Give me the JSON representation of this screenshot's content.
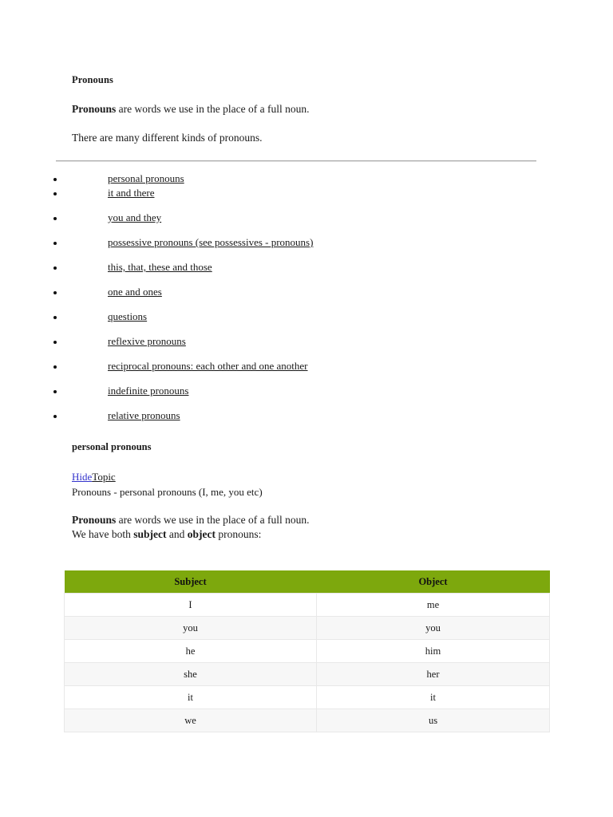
{
  "document": {
    "title": "Pronouns",
    "intro": {
      "lead": "Pronouns",
      "rest": " are words we use in the place of a full noun.",
      "second_line": "There are many different kinds of pronouns."
    },
    "topics": [
      {
        "label": "personal pronouns"
      },
      {
        "label": "it and there"
      },
      {
        "label": "you and they"
      },
      {
        "label": "possessive pronouns (see possessives - pronouns)"
      },
      {
        "label": "this, that, these and those"
      },
      {
        "label": "one and ones"
      },
      {
        "label": "questions"
      },
      {
        "label": "reflexive pronouns"
      },
      {
        "label": "reciprocal pronouns: each other and one another"
      },
      {
        "label": "indefinite pronouns"
      },
      {
        "label": "relative pronouns"
      }
    ],
    "section": {
      "heading": "personal pronouns",
      "hide_label": "Hide",
      "topic_label": "Topic",
      "subtitle": "Pronouns - personal pronouns (I, me, you etc)",
      "description_lead": "Pronouns",
      "description_rest": " are words we use in the place of a full noun.",
      "description_line2_prefix": "We have both ",
      "description_line2_bold1": "subject",
      "description_line2_mid": " and ",
      "description_line2_bold2": "object",
      "description_line2_suffix": " pronouns:"
    },
    "table": {
      "header_background": "#7da80d",
      "columns": [
        "Subject",
        "Object"
      ],
      "rows": [
        [
          "I",
          "me"
        ],
        [
          "you",
          "you"
        ],
        [
          "he",
          "him"
        ],
        [
          "she",
          "her"
        ],
        [
          "it",
          "it"
        ],
        [
          "we",
          "us"
        ]
      ]
    }
  }
}
